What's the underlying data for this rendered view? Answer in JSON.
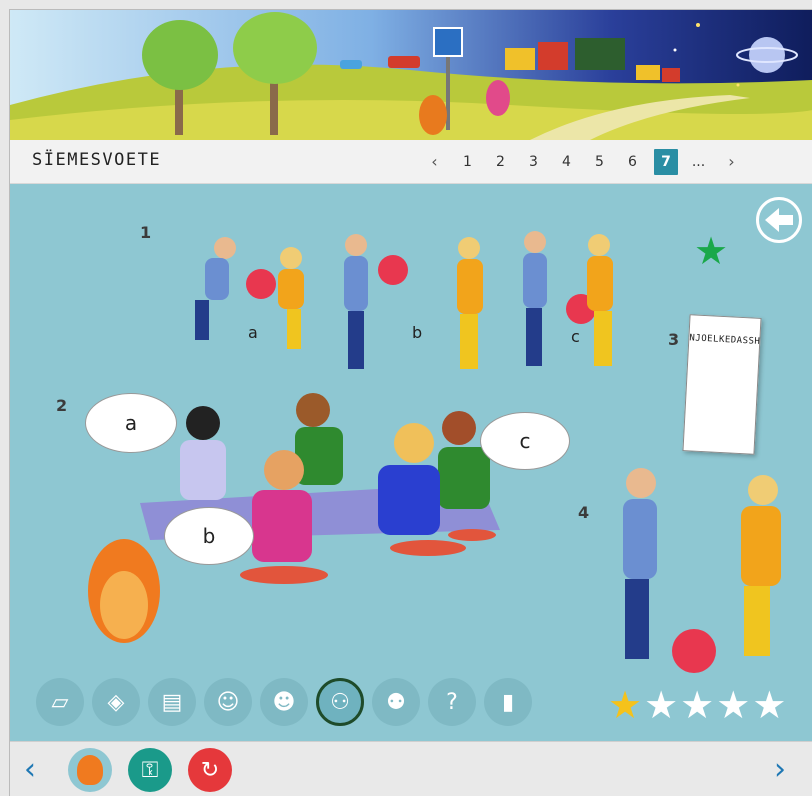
{
  "header": {
    "title": "SÏEMESVOETE",
    "pages": [
      "1",
      "2",
      "3",
      "4",
      "5",
      "6",
      "7",
      "..."
    ],
    "current_page": "7",
    "prev": "‹",
    "next": "›"
  },
  "scene": {
    "task_labels": [
      "1",
      "2",
      "3",
      "4"
    ],
    "task1_options": [
      "a",
      "b",
      "c"
    ],
    "task2_bubbles": [
      "a",
      "b",
      "c"
    ],
    "booklet_title": "NJOELKEDASSH"
  },
  "icons": [
    {
      "name": "eraser-icon"
    },
    {
      "name": "backpack-icon"
    },
    {
      "name": "paper-icon"
    },
    {
      "name": "boy-backpack-icon"
    },
    {
      "name": "boy-reading-icon"
    },
    {
      "name": "greeting-icon",
      "active": true
    },
    {
      "name": "class-group-icon"
    },
    {
      "name": "question-icon"
    },
    {
      "name": "chart-icon"
    }
  ],
  "rating": {
    "value": 1,
    "max": 5
  },
  "colors": {
    "accent": "#2a8ea4",
    "background": "#8ec7d2",
    "nav": "#1f78b4",
    "star": "#f5c21b"
  },
  "bottom": {
    "prev": "‹",
    "next": "›"
  }
}
